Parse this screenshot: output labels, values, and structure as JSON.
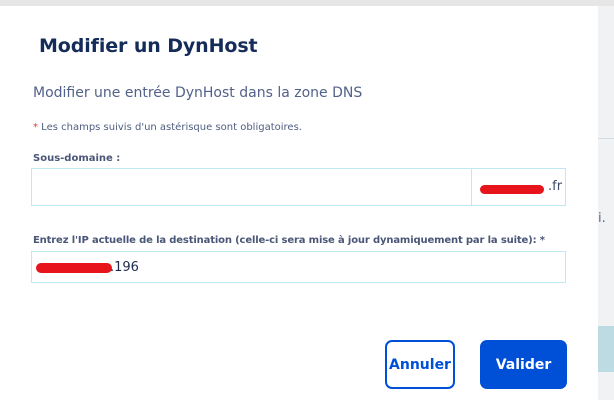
{
  "modal": {
    "title": "Modifier un DynHost",
    "subtitle": "Modifier une entrée DynHost dans la zone DNS",
    "required_note": {
      "star": "*",
      "text": " Les champs suivis d'un astérisque sont obligatoires."
    }
  },
  "form": {
    "subdomain": {
      "label": "Sous-domaine :",
      "value": "",
      "placeholder": "",
      "domain_suffix": ".fr"
    },
    "ip": {
      "label": "Entrez l'IP actuelle de la destination (celle-ci sera mise à jour dynamiquement par la suite):",
      "required_mark": "*",
      "value": ".196"
    }
  },
  "buttons": {
    "cancel_label": "Annuler",
    "submit_label": "Valider"
  },
  "background": {
    "ellipsis": "i."
  },
  "colors": {
    "primary": "#0050d7",
    "title": "#152b58",
    "input_border": "#bfe9f0",
    "redaction": "#e8141c",
    "required_star": "#e53935"
  }
}
